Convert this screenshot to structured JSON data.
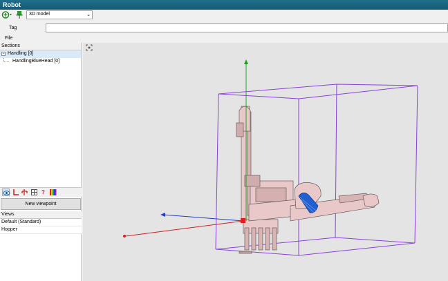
{
  "window": {
    "title": "Robot"
  },
  "toolbar": {
    "add_icon": "circle-plus-icon",
    "pin_icon": "pin-icon",
    "view_select": "3D model"
  },
  "form": {
    "tag_label": "Tag",
    "tag_value": "",
    "file_label": "File"
  },
  "sections": {
    "header": "Sections",
    "items": [
      {
        "label": "Handling [0]",
        "expander": "−"
      },
      {
        "label": "HandlingBlueHead [0]"
      }
    ]
  },
  "lower_toolbar": {
    "icons": [
      "eye-icon",
      "axes-icon",
      "robot-icon",
      "frame-icon",
      "help-icon",
      "colors-icon"
    ],
    "glyphs": [
      "👁",
      "└",
      "⚙",
      "▣",
      "?",
      "▥"
    ]
  },
  "new_viewpoint_label": "New viewpoint",
  "views": {
    "header": "Views",
    "items": [
      "Default (Standard)",
      "Hopper"
    ]
  },
  "viewport": {
    "corner_icon": "focus-icon"
  },
  "colors": {
    "titlebar": "#1a6680",
    "bbox": "#8a3fe0",
    "robot": "#e8c8c8",
    "gripper": "#2060d0",
    "axis_x": "#d02020",
    "axis_y": "#20a020",
    "axis_z": "#2040c0"
  }
}
